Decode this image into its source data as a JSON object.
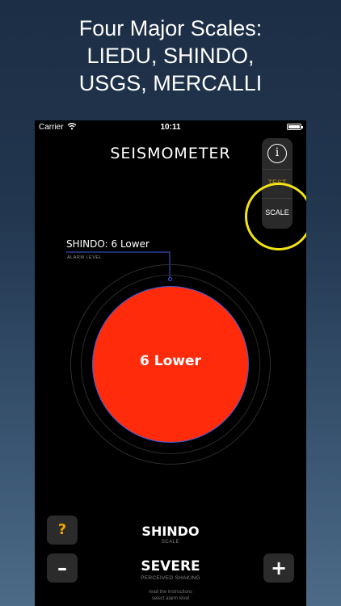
{
  "headline": {
    "line1": "Four Major Scales:",
    "line2": "LIEDU, SHINDO,",
    "line3": "USGS, MERCALLI"
  },
  "status_bar": {
    "carrier": "Carrier",
    "time": "10:11",
    "icons": [
      "wifi-icon",
      "battery-icon"
    ]
  },
  "app": {
    "title": "SEISMOMETER",
    "side_panel": {
      "info_glyph": "i",
      "test_label": "TEST",
      "scale_label": "SCALE"
    },
    "alarm": {
      "text": "SHINDO: 6 Lower",
      "sublabel": "ALARM LEVEL"
    },
    "gauge": {
      "value_text": "6 Lower",
      "fill_color": "#ff2b0b",
      "ring_color": "#3b5de0"
    },
    "bottom": {
      "help_glyph": "?",
      "minus_glyph": "–",
      "plus_glyph": "+",
      "scale_name": "SHINDO",
      "scale_sublabel": "SCALE",
      "shaking_level": "SEVERE",
      "shaking_sublabel": "PERCEIVED SHAKING",
      "hint_line1": "read the instructions",
      "hint_line2": "select alarm level"
    }
  },
  "colors": {
    "accent_yellow": "#f2e316",
    "test_label": "#b58a19",
    "help_icon": "#f0a500"
  }
}
